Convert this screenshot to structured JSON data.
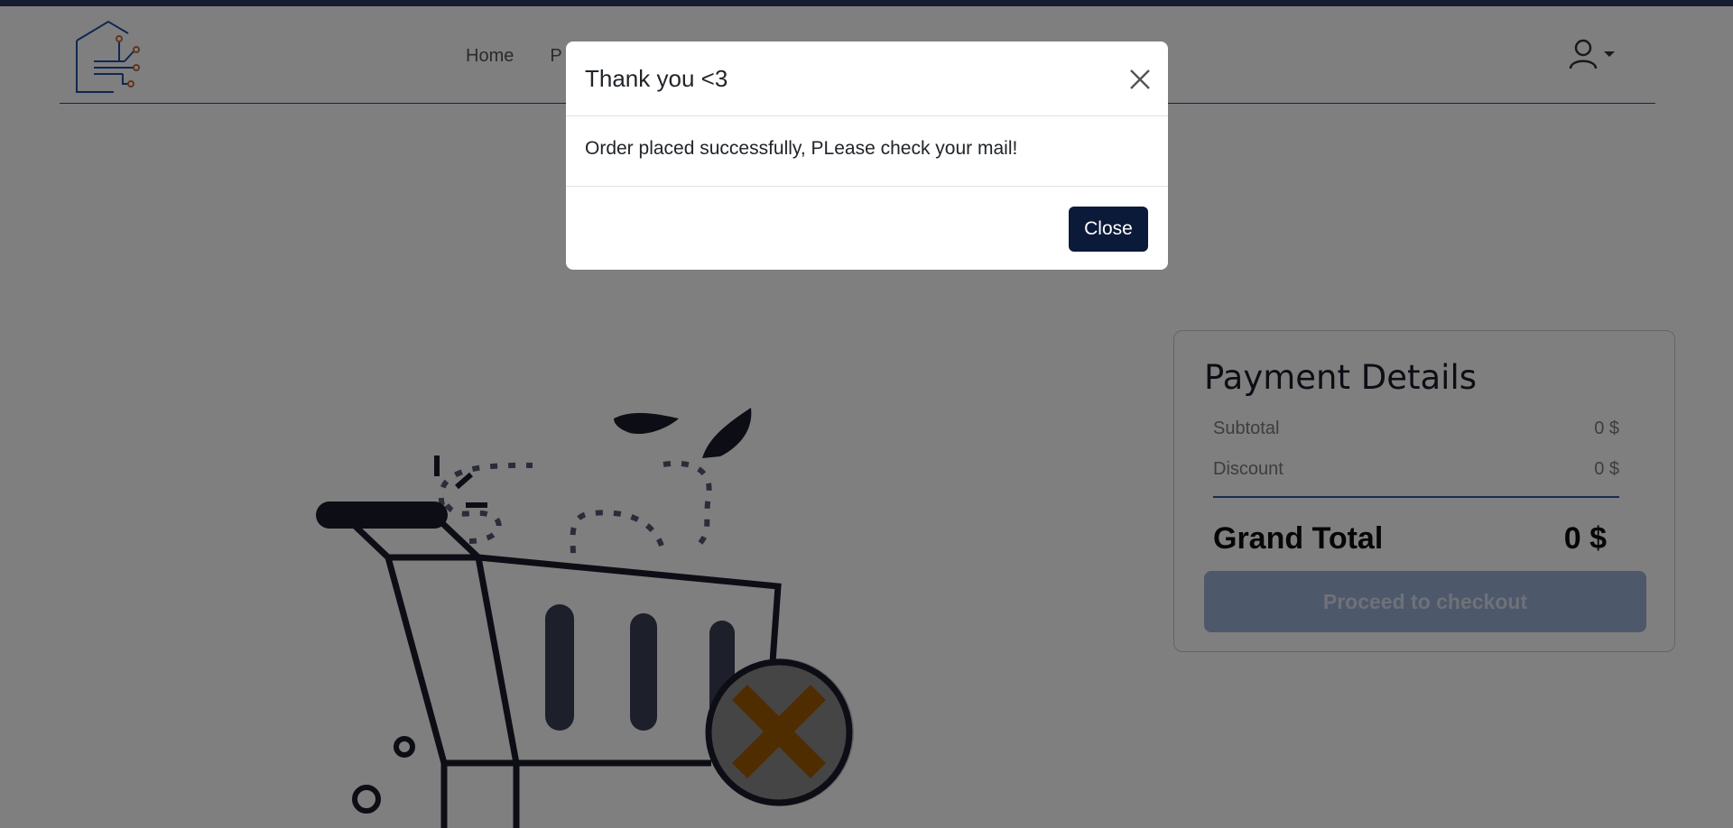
{
  "nav": {
    "links": [
      "Home",
      "P"
    ]
  },
  "payment": {
    "title": "Payment Details",
    "subtotal_label": "Subtotal",
    "subtotal_value": "0 $",
    "discount_label": "Discount",
    "discount_value": "0 $",
    "grand_total_label": "Grand Total",
    "grand_total_value": "0 $",
    "checkout_label": "Proceed to checkout"
  },
  "modal": {
    "title": "Thank you <3",
    "message": "Order placed successfully, PLease check your mail!",
    "close_label": "Close"
  },
  "colors": {
    "accent": "#1f4fa5",
    "top_bar": "#2a3c63",
    "close_button": "#0c1a3a",
    "checkout_button": "#9cb1d6",
    "empty_cart_x": "#a05a00"
  }
}
